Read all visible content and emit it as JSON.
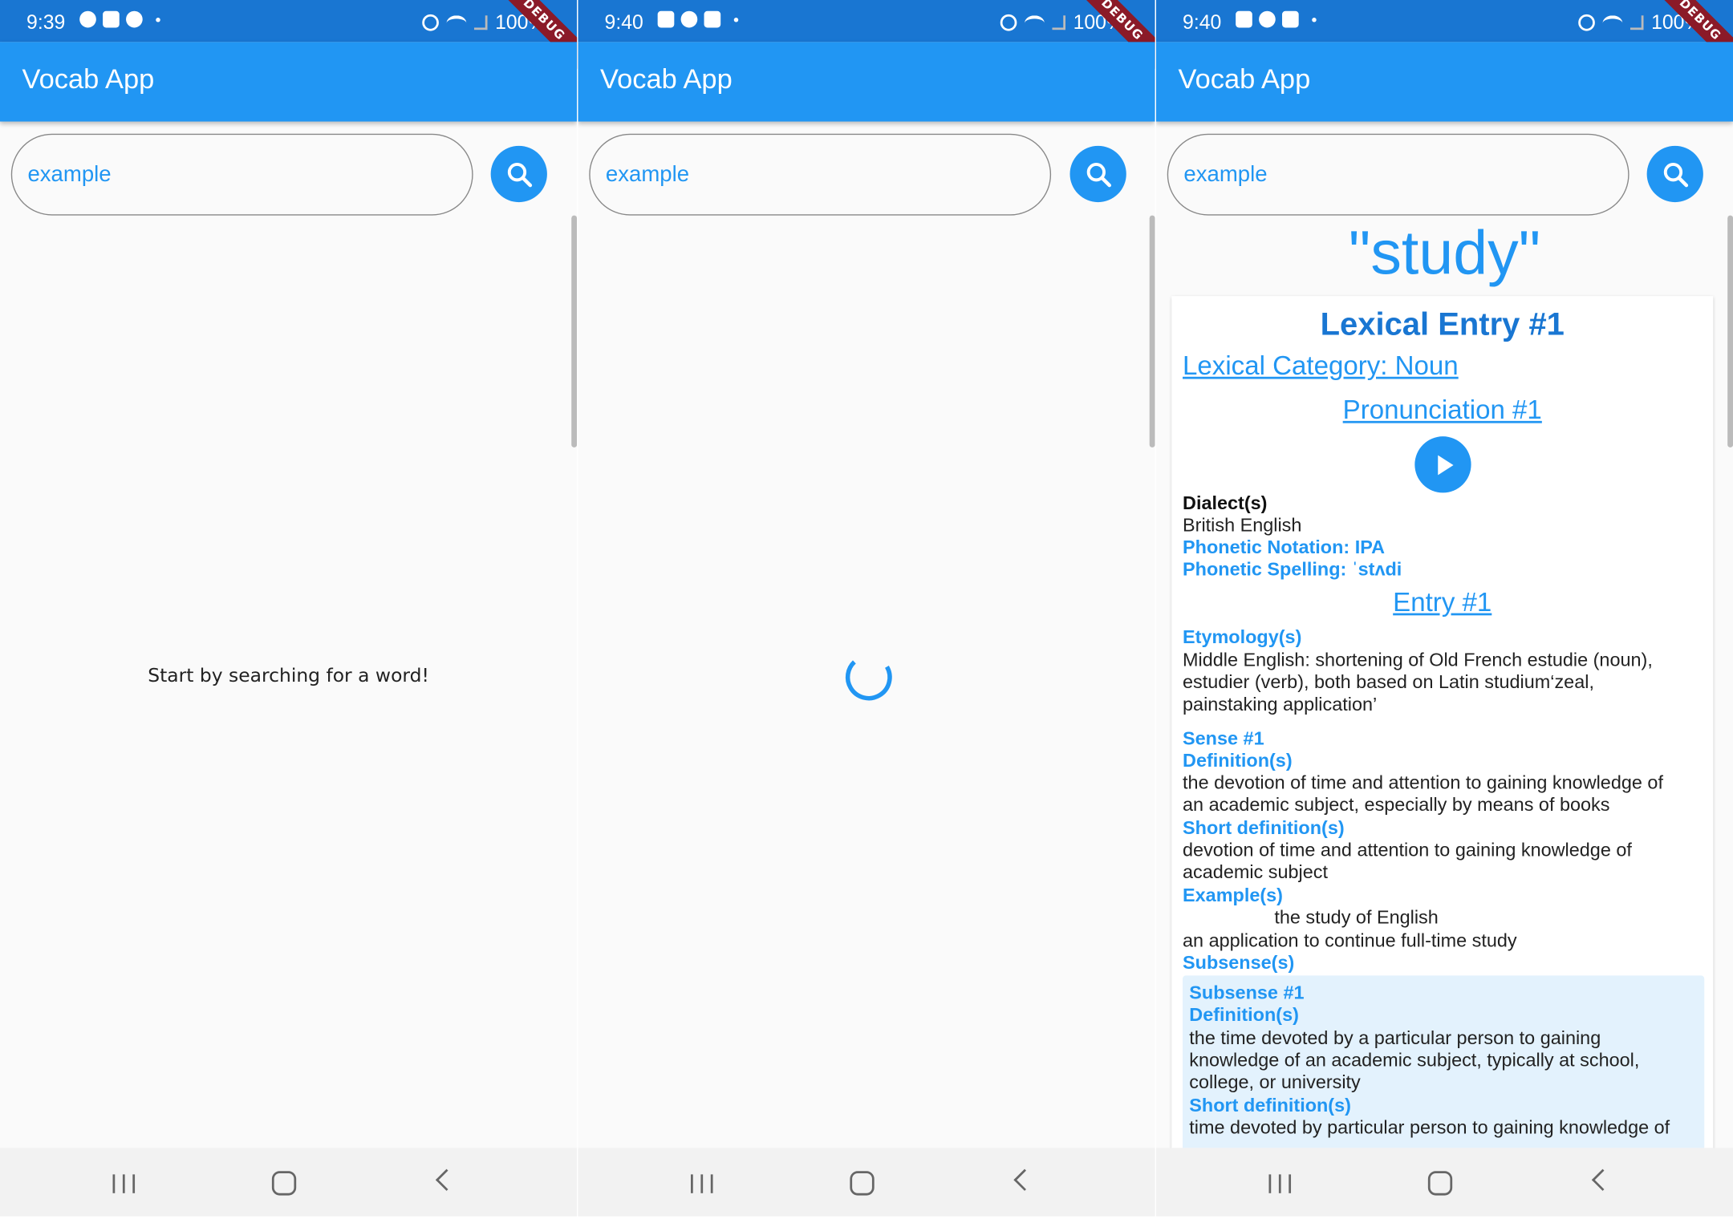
{
  "statusbar": [
    {
      "time": "9:39",
      "battery": "100%"
    },
    {
      "time": "9:40",
      "battery": "100%"
    },
    {
      "time": "9:40",
      "battery": "100%"
    }
  ],
  "debug_banner": "DEBUG",
  "app_title": "Vocab App",
  "search": {
    "value": "example"
  },
  "screen1": {
    "empty_message": "Start by searching for a word!"
  },
  "result": {
    "word": "\"study\"",
    "lexical_entry_title": "Lexical Entry #1",
    "lexical_category": "Lexical Category: Noun",
    "pronunciation_title": "Pronunciation #1",
    "dialects_label": "Dialect(s)",
    "dialect": "British English",
    "phonetic_notation": "Phonetic Notation: IPA",
    "phonetic_spelling": "Phonetic Spelling: ˈstʌdi",
    "entry_title": "Entry #1",
    "etymology_label": "Etymology(s)",
    "etymology_lines": [
      "Middle English: shortening of Old French estudie (noun),",
      "estudier (verb), both based on Latin studium‘zeal,",
      "painstaking application’"
    ],
    "sense_label": "Sense #1",
    "definitions_label": "Definition(s)",
    "definition_lines": [
      "the devotion of time and attention to gaining knowledge of",
      "an academic subject, especially by means of books"
    ],
    "short_definitions_label": "Short definition(s)",
    "short_definition_lines": [
      "devotion of time and attention to gaining knowledge of",
      "academic subject"
    ],
    "examples_label": "Example(s)",
    "example_1": "the study of English",
    "example_2": "an application to continue full-time study",
    "subsenses_label": "Subsense(s)",
    "subsense": {
      "label": "Subsense #1",
      "definitions_label": "Definition(s)",
      "definition_lines": [
        "the time devoted by a particular person to gaining",
        "knowledge of an academic subject, typically at school,",
        "college, or university"
      ],
      "short_definitions_label": "Short definition(s)",
      "short_definition_line": "time devoted by particular person to gaining knowledge of"
    }
  },
  "colors": {
    "appbar": "#2196f3",
    "statusbar": "#1976d2",
    "accent": "#2196f3",
    "subsense_bg": "#e3f2fd"
  }
}
